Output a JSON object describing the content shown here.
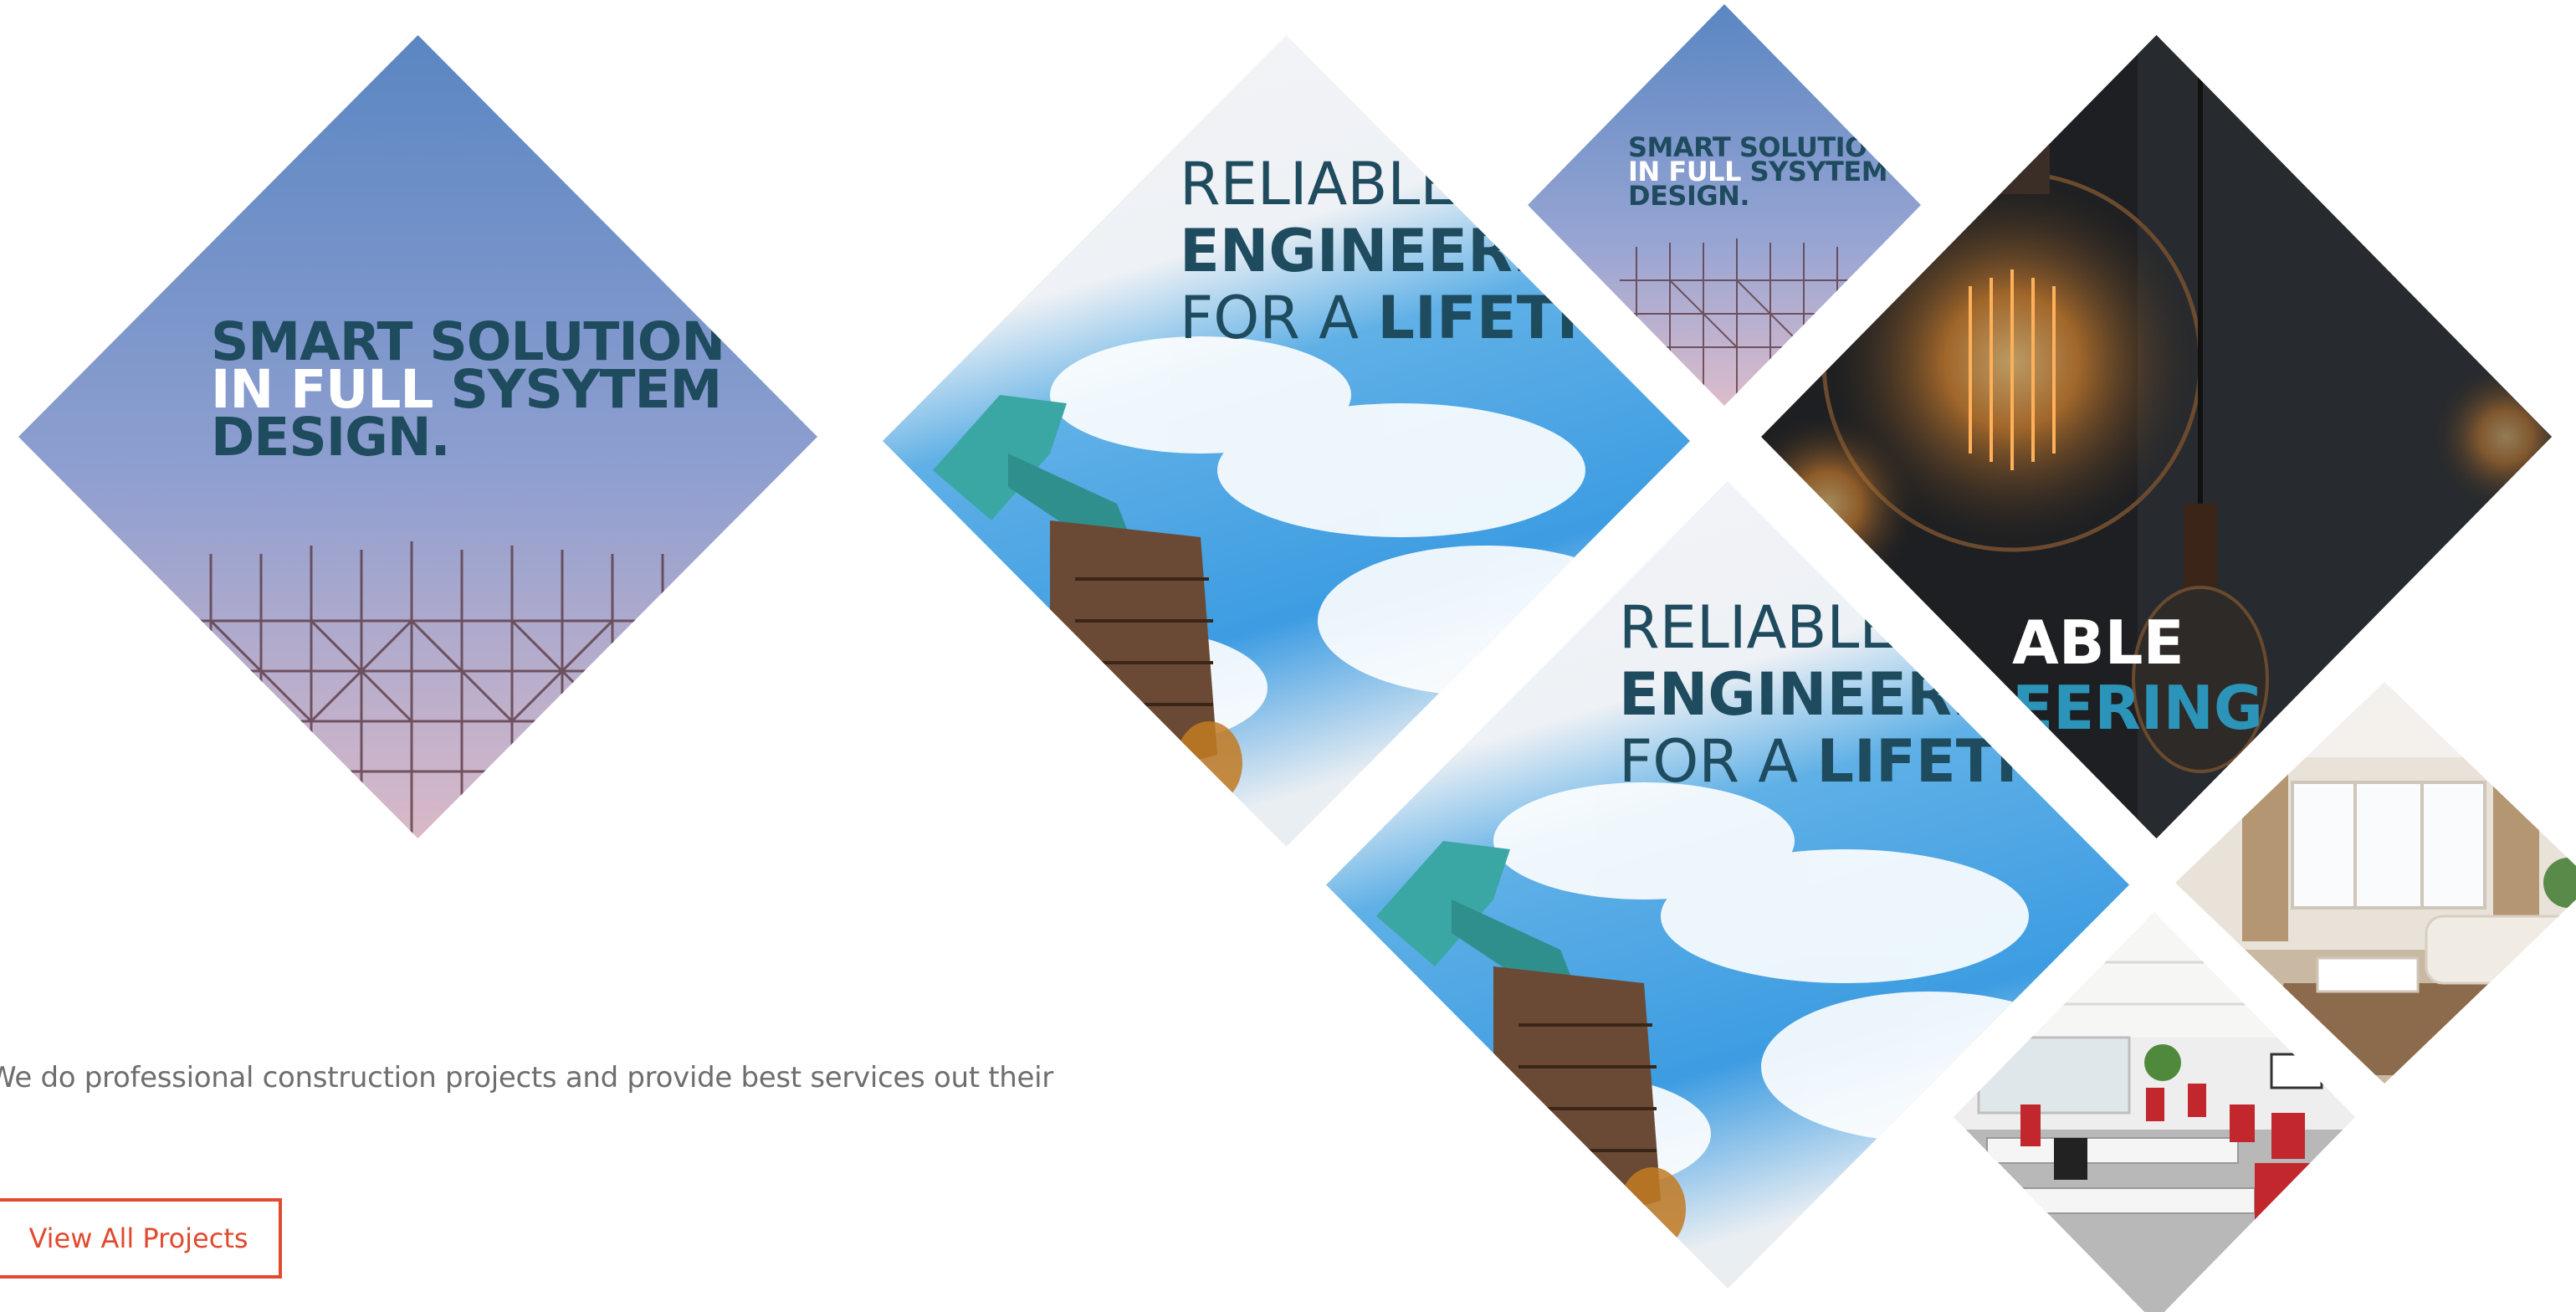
{
  "projects": {
    "tiles": [
      {
        "name": "smart-solution",
        "lines": [
          "SMART SOLUTION",
          "IN FULL",
          "SYSYTEM",
          "DESIGN."
        ]
      },
      {
        "name": "reliable-engineering",
        "lines": [
          "RELIABLE",
          "ENGINEERI",
          "FOR A",
          "LIFETI"
        ]
      },
      {
        "name": "smart-solution-small",
        "lines": [
          "SMART SOLUTIO",
          "IN FULL",
          "SYSYTEM",
          "DESIGN."
        ]
      },
      {
        "name": "light-bulbs",
        "lines": [
          "ABLE",
          "EERING"
        ]
      },
      {
        "name": "reliable-engineering-2",
        "lines": [
          "RELIABLE",
          "ENGINEERI",
          "FOR A",
          "LIFETI"
        ]
      },
      {
        "name": "living-room"
      },
      {
        "name": "office"
      }
    ],
    "description": "We do professional construction projects and provide best services out their",
    "cta_label": "View All Projects"
  },
  "colors": {
    "accent": "#e2492e",
    "banner_text": "#1f4b5f",
    "description_text": "#6e6e6e"
  }
}
